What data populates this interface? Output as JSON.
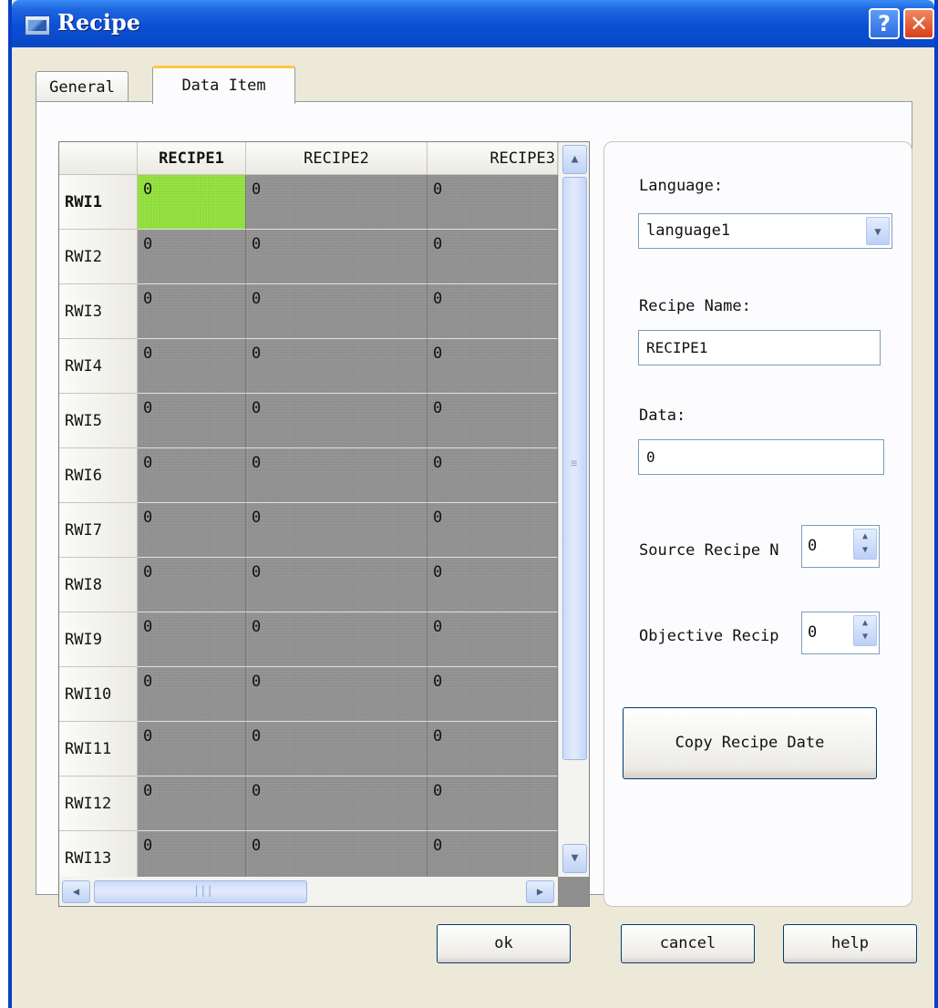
{
  "window": {
    "title": "Recipe",
    "help_glyph": "?",
    "close_glyph": "✕"
  },
  "tabs": [
    {
      "label": "General"
    },
    {
      "label": "Data Item"
    }
  ],
  "grid": {
    "columns": [
      "RECIPE1",
      "RECIPE2",
      "RECIPE3"
    ],
    "rows": [
      {
        "name": "RWI1",
        "values": [
          "0",
          "0",
          "0"
        ]
      },
      {
        "name": "RWI2",
        "values": [
          "0",
          "0",
          "0"
        ]
      },
      {
        "name": "RWI3",
        "values": [
          "0",
          "0",
          "0"
        ]
      },
      {
        "name": "RWI4",
        "values": [
          "0",
          "0",
          "0"
        ]
      },
      {
        "name": "RWI5",
        "values": [
          "0",
          "0",
          "0"
        ]
      },
      {
        "name": "RWI6",
        "values": [
          "0",
          "0",
          "0"
        ]
      },
      {
        "name": "RWI7",
        "values": [
          "0",
          "0",
          "0"
        ]
      },
      {
        "name": "RWI8",
        "values": [
          "0",
          "0",
          "0"
        ]
      },
      {
        "name": "RWI9",
        "values": [
          "0",
          "0",
          "0"
        ]
      },
      {
        "name": "RWI10",
        "values": [
          "0",
          "0",
          "0"
        ]
      },
      {
        "name": "RWI11",
        "values": [
          "0",
          "0",
          "0"
        ]
      },
      {
        "name": "RWI12",
        "values": [
          "0",
          "0",
          "0"
        ]
      },
      {
        "name": "RWI13",
        "values": [
          "0",
          "0",
          "0"
        ]
      }
    ],
    "active_cell_color": "#8edc3a"
  },
  "side": {
    "language_label": "Language:",
    "language_value": "language1",
    "recipe_name_label": "Recipe Name:",
    "recipe_name_value": "RECIPE1",
    "data_label": "Data:",
    "data_value": "0",
    "source_label": "Source Recipe N",
    "source_value": "0",
    "objective_label": "Objective Recip",
    "objective_value": "0",
    "copy_button": "Copy Recipe Date"
  },
  "footer": {
    "ok": "ok",
    "cancel": "cancel",
    "help": "help"
  }
}
